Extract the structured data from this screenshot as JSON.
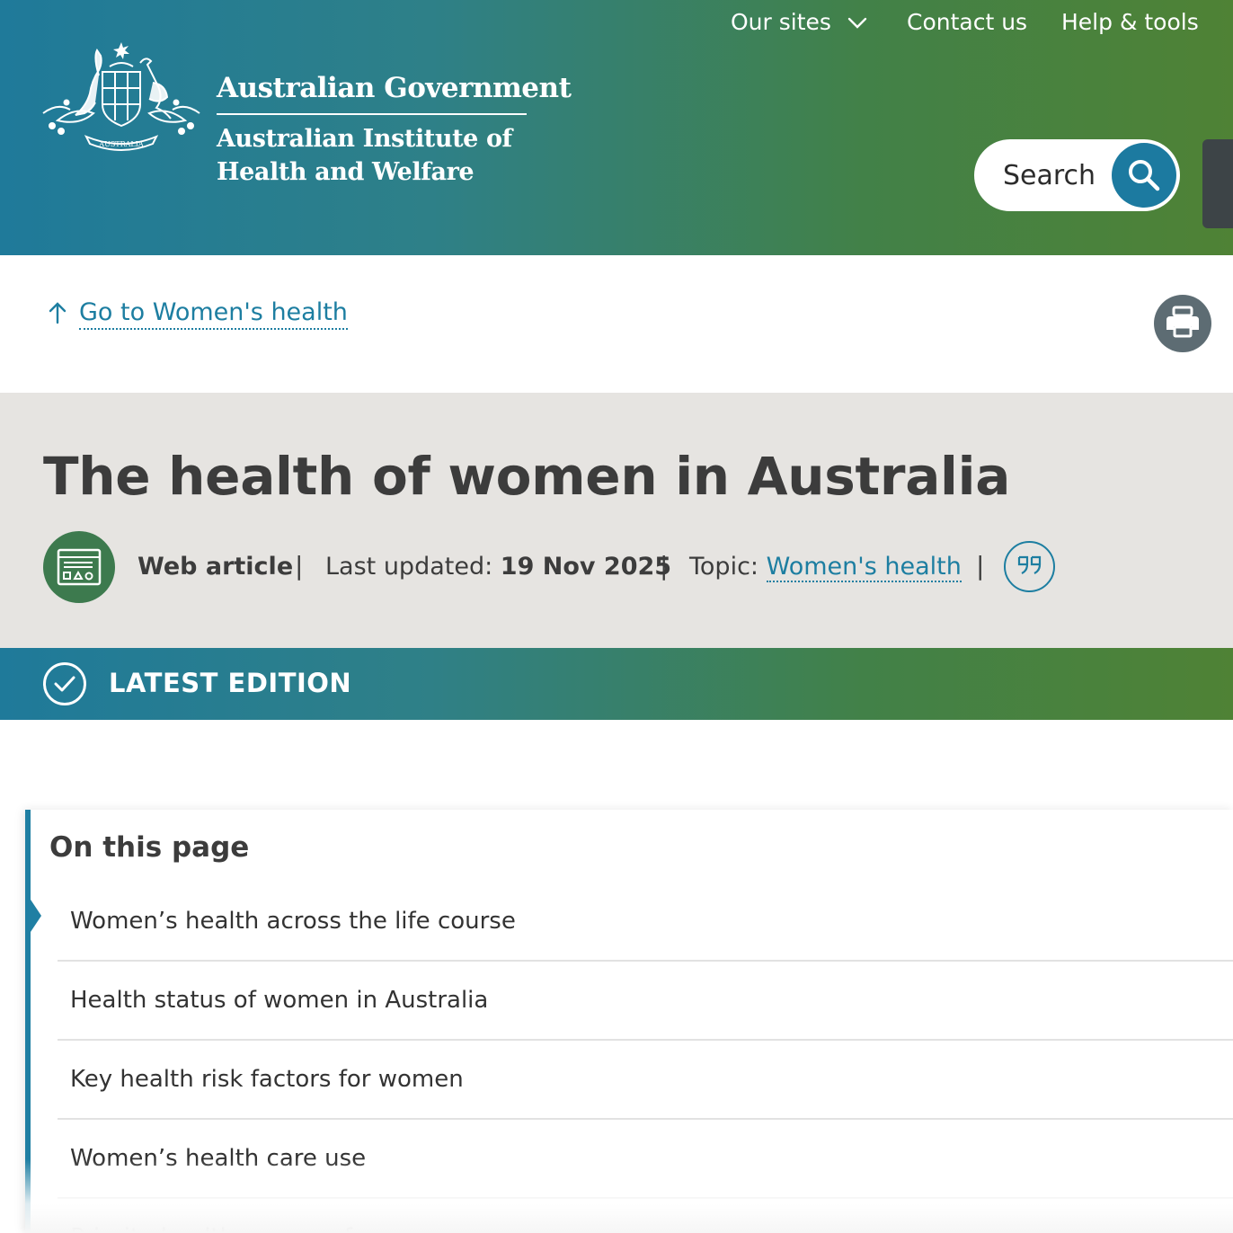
{
  "header": {
    "utility_nav": {
      "our_sites": "Our sites",
      "contact_us": "Contact us",
      "help_tools": "Help & tools"
    },
    "gov_title": "Australian Government",
    "agency_line1": "Australian Institute of",
    "agency_line2": "Health and Welfare",
    "crest_label": "AUSTRALIA",
    "search_label": "Search"
  },
  "breadcrumb": {
    "label": "Go to Women's health"
  },
  "article": {
    "title": "The health of women in Australia",
    "type": "Web article",
    "last_updated_label": "Last updated:",
    "last_updated_value": "19 Nov 2025",
    "topic_label": "Topic:",
    "topic_value": "Women's health",
    "separator": "|"
  },
  "edition": {
    "label": "LATEST EDITION"
  },
  "on_this_page": {
    "title": "On this page",
    "items": [
      "Women’s health across the life course",
      "Health status of women in Australia",
      "Key health risk factors for women",
      "Women’s health care use",
      "Priority health groups of women"
    ]
  },
  "colors": {
    "header_gradient_start": "#1f7a9a",
    "header_gradient_end": "#4f8235",
    "link": "#1d7ea1",
    "search_circle": "#1c7aa0",
    "type_icon": "#3d7a4e",
    "title_band": "#e6e4e1"
  },
  "icons": [
    "chevron-down-icon",
    "coat-of-arms-icon",
    "search-icon",
    "arrow-up-icon",
    "print-icon",
    "web-article-icon",
    "quote-icon",
    "check-circle-icon"
  ]
}
